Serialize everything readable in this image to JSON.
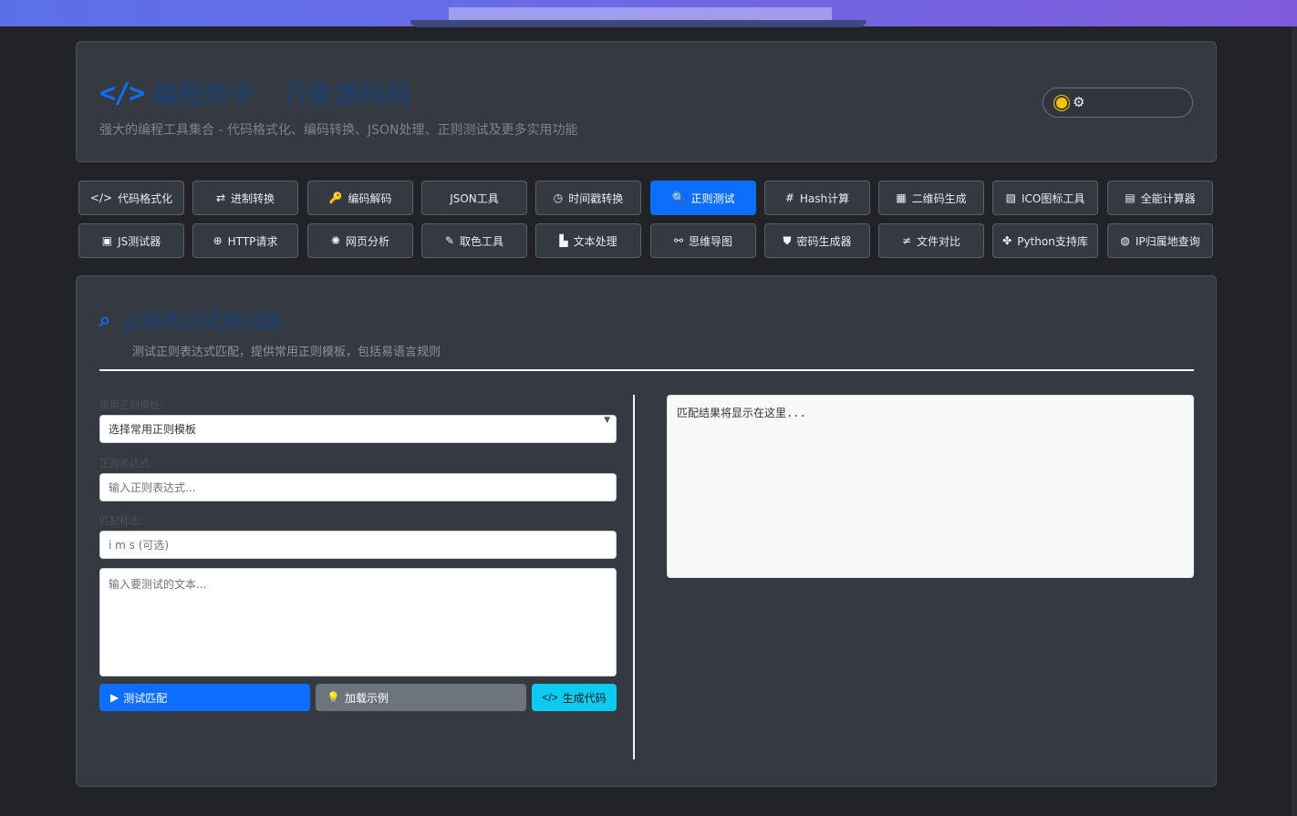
{
  "header": {
    "brand_icon": "</>",
    "title": "编程助手 - 万象源码网",
    "subtitle": "强大的编程工具集合 - 代码格式化、编码转换、JSON处理、正则测试及更多实用功能",
    "theme_icons": [
      "sun-icon",
      "gear-icon"
    ]
  },
  "tools": {
    "row1": [
      {
        "icon": "</>",
        "label": "代码格式化"
      },
      {
        "icon": "⇄",
        "label": "进制转换"
      },
      {
        "icon": "🔑",
        "label": "编码解码"
      },
      {
        "icon": "",
        "label": "JSON工具"
      },
      {
        "icon": "◷",
        "label": "时间戳转换"
      },
      {
        "icon": "🔍",
        "label": "正则测试"
      },
      {
        "icon": "#",
        "label": "Hash计算"
      },
      {
        "icon": "▦",
        "label": "二维码生成"
      },
      {
        "icon": "▨",
        "label": "ICO图标工具"
      },
      {
        "icon": "▤",
        "label": "全能计算器"
      }
    ],
    "row2": [
      {
        "icon": "▣",
        "label": "JS测试器"
      },
      {
        "icon": "⊕",
        "label": "HTTP请求"
      },
      {
        "icon": "✺",
        "label": "网页分析"
      },
      {
        "icon": "✎",
        "label": "取色工具"
      },
      {
        "icon": "▙",
        "label": "文本处理"
      },
      {
        "icon": "⚯",
        "label": "思维导图"
      },
      {
        "icon": "⛊",
        "label": "密码生成器"
      },
      {
        "icon": "≠",
        "label": "文件对比"
      },
      {
        "icon": "✤",
        "label": "Python支持库"
      },
      {
        "icon": "◍",
        "label": "IP归属地查询"
      }
    ],
    "active": "正则测试"
  },
  "panel": {
    "title": "正则表达式测试器",
    "description": "测试正则表达式匹配，提供常用正则模板，包括易语言规则",
    "template_label": "常用正则模板:",
    "template_selected": "选择常用正则模板",
    "pattern_label": "正则表达式:",
    "pattern_placeholder": "输入正则表达式...",
    "flags_label": "匹配标志:",
    "flags_placeholder": "i m s (可选)",
    "text_placeholder": "输入要测试的文本...",
    "test_button": "测试匹配",
    "example_button": "加载示例",
    "code_button": "生成代码",
    "result_placeholder": "匹配结果将显示在这里..."
  },
  "colors": {
    "accent": "#0d6efd",
    "secondary": "#6c757d",
    "info": "#0dcaf0",
    "card_bg": "#343a40",
    "page_bg": "#212327"
  }
}
